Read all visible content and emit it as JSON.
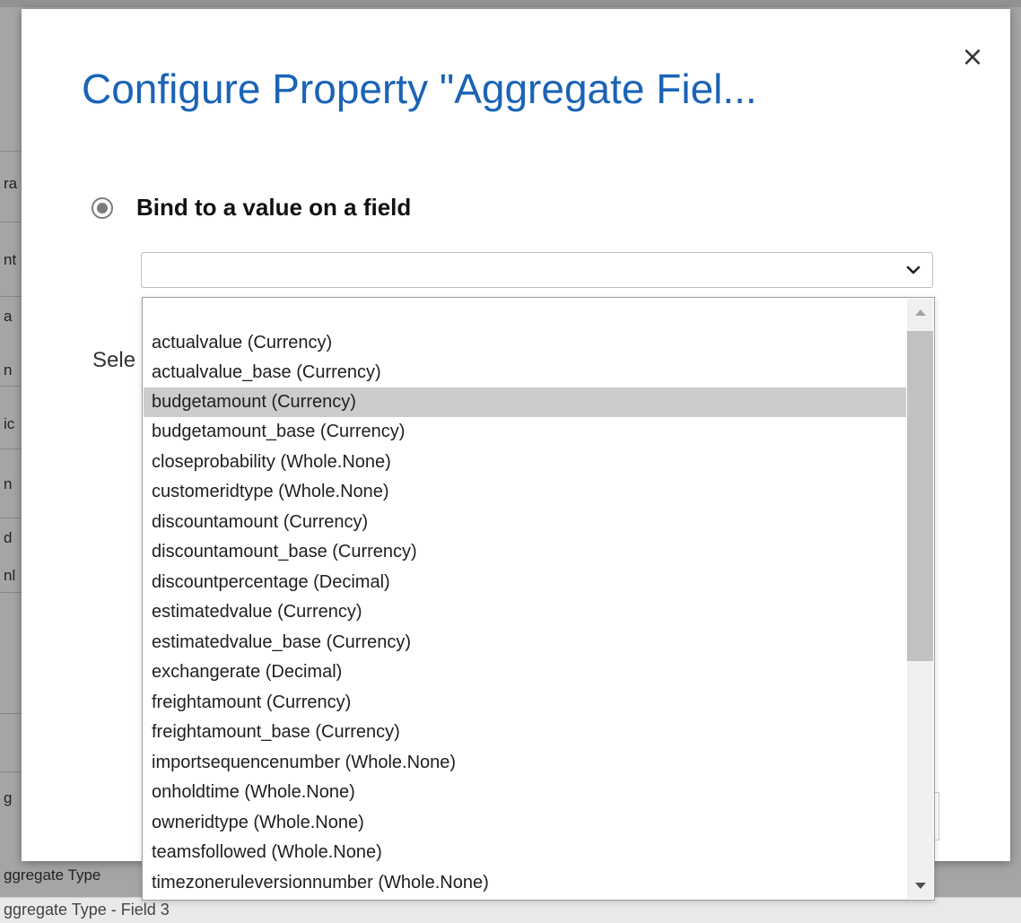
{
  "background": {
    "fragments": [
      "ra",
      "nt",
      "a",
      "n",
      "ic",
      "n",
      "d",
      "nl",
      "g",
      "ggregate Type"
    ],
    "bottom_text": "ggregate Type - Field 3"
  },
  "dialog": {
    "title": "Configure Property \"Aggregate Fiel...",
    "close_glyph": "×",
    "radio_label": "Bind to a value on a field",
    "select_value": "",
    "partial_label": "Sele"
  },
  "dropdown": {
    "options": [
      "",
      "actualvalue (Currency)",
      "actualvalue_base (Currency)",
      "budgetamount (Currency)",
      "budgetamount_base (Currency)",
      "closeprobability (Whole.None)",
      "customeridtype (Whole.None)",
      "discountamount (Currency)",
      "discountamount_base (Currency)",
      "discountpercentage (Decimal)",
      "estimatedvalue (Currency)",
      "estimatedvalue_base (Currency)",
      "exchangerate (Decimal)",
      "freightamount (Currency)",
      "freightamount_base (Currency)",
      "importsequencenumber (Whole.None)",
      "onholdtime (Whole.None)",
      "owneridtype (Whole.None)",
      "teamsfollowed (Whole.None)",
      "timezoneruleversionnumber (Whole.None)"
    ],
    "selected_index": 3
  },
  "colors": {
    "title": "#1b63b6",
    "highlight": "#cccccc"
  }
}
